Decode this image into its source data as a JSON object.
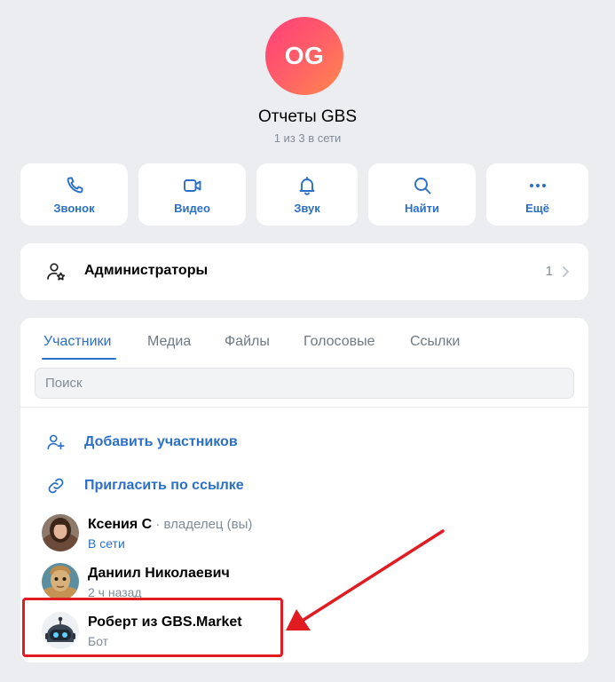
{
  "chat": {
    "avatar_initials": "OG",
    "title": "Отчеты GBS",
    "subtitle": "1 из 3 в сети"
  },
  "actions": [
    {
      "label": "Звонок",
      "icon": "phone-icon"
    },
    {
      "label": "Видео",
      "icon": "video-icon"
    },
    {
      "label": "Звук",
      "icon": "bell-icon"
    },
    {
      "label": "Найти",
      "icon": "search-icon"
    },
    {
      "label": "Ещё",
      "icon": "more-dots-icon"
    }
  ],
  "admins": {
    "label": "Администраторы",
    "count": "1",
    "icon": "user-star-icon"
  },
  "tabs": [
    {
      "label": "Участники",
      "active": true
    },
    {
      "label": "Медиа",
      "active": false
    },
    {
      "label": "Файлы",
      "active": false
    },
    {
      "label": "Голосовые",
      "active": false
    },
    {
      "label": "Ссылки",
      "active": false
    }
  ],
  "search": {
    "placeholder": "Поиск",
    "value": ""
  },
  "member_actions": [
    {
      "label": "Добавить участников",
      "icon": "add-user-icon"
    },
    {
      "label": "Пригласить по ссылке",
      "icon": "link-icon"
    }
  ],
  "members": [
    {
      "name": "Ксения С",
      "role": " · владелец (вы)",
      "status": "В сети",
      "online": true
    },
    {
      "name": "Даниил Николаевич",
      "role": "",
      "status": "2 ч назад",
      "online": false
    },
    {
      "name": "Роберт из GBS.Market",
      "role": "",
      "status": "Бот",
      "online": false
    }
  ],
  "colors": {
    "accent": "#2b6fc8",
    "highlight": "#e11b22",
    "background": "#ebedf0"
  }
}
